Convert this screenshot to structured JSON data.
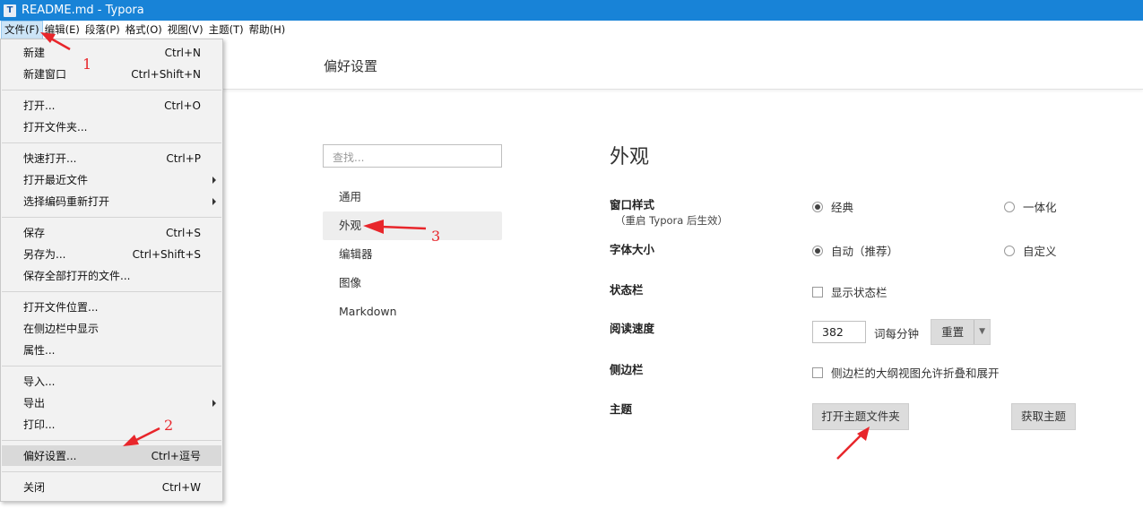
{
  "window": {
    "title": "README.md - Typora",
    "app_icon_glyph": "T"
  },
  "menubar": {
    "items": [
      {
        "label": "文件(F)",
        "active": true
      },
      {
        "label": "编辑(E)"
      },
      {
        "label": "段落(P)"
      },
      {
        "label": "格式(O)"
      },
      {
        "label": "视图(V)"
      },
      {
        "label": "主题(T)"
      },
      {
        "label": "帮助(H)"
      }
    ]
  },
  "file_menu": {
    "items": [
      {
        "label": "新建",
        "shortcut": "Ctrl+N"
      },
      {
        "label": "新建窗口",
        "shortcut": "Ctrl+Shift+N"
      },
      {
        "label": "打开...",
        "shortcut": "Ctrl+O"
      },
      {
        "label": "打开文件夹...",
        "shortcut": ""
      },
      {
        "label": "快速打开...",
        "shortcut": "Ctrl+P"
      },
      {
        "label": "打开最近文件",
        "shortcut": "",
        "submenu": true
      },
      {
        "label": "选择编码重新打开",
        "shortcut": "",
        "submenu": true
      },
      {
        "label": "保存",
        "shortcut": "Ctrl+S"
      },
      {
        "label": "另存为...",
        "shortcut": "Ctrl+Shift+S"
      },
      {
        "label": "保存全部打开的文件...",
        "shortcut": ""
      },
      {
        "label": "打开文件位置...",
        "shortcut": ""
      },
      {
        "label": "在侧边栏中显示",
        "shortcut": ""
      },
      {
        "label": "属性...",
        "shortcut": ""
      },
      {
        "label": "导入...",
        "shortcut": ""
      },
      {
        "label": "导出",
        "shortcut": "",
        "submenu": true
      },
      {
        "label": "打印...",
        "shortcut": ""
      },
      {
        "label": "偏好设置...",
        "shortcut": "Ctrl+逗号",
        "highlighted": true
      },
      {
        "label": "关闭",
        "shortcut": "Ctrl+W"
      }
    ]
  },
  "preferences": {
    "title": "偏好设置",
    "search_placeholder": "查找...",
    "nav": [
      "通用",
      "外观",
      "编辑器",
      "图像",
      "Markdown"
    ],
    "selected_nav": "外观",
    "section_title": "外观",
    "window_style": {
      "label": "窗口样式",
      "note": "（重启 Typora 后生效）",
      "option_classic": "经典",
      "option_unified": "一体化",
      "selected": "经典"
    },
    "font_size": {
      "label": "字体大小",
      "option_auto": "自动（推荐）",
      "option_custom": "自定义",
      "selected": "自动（推荐）"
    },
    "status_bar": {
      "label": "状态栏",
      "checkbox_label": "显示状态栏",
      "checked": false
    },
    "reading_speed": {
      "label": "阅读速度",
      "value": "382",
      "unit": "词每分钟",
      "reset_label": "重置"
    },
    "sidebar": {
      "label": "侧边栏",
      "checkbox_label": "侧边栏的大纲视图允许折叠和展开",
      "checked": false
    },
    "theme": {
      "label": "主题",
      "open_folder_label": "打开主题文件夹",
      "get_themes_label": "获取主题"
    }
  },
  "annotations": {
    "n1": "1",
    "n2": "2",
    "n3": "3",
    "color": "#e8262b"
  }
}
